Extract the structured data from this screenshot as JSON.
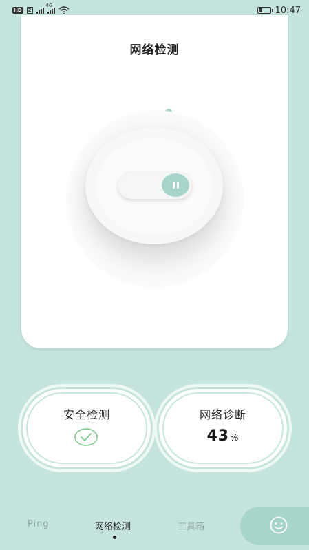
{
  "status_bar": {
    "hd": "HD",
    "sim": "2",
    "network": "4G",
    "time": "10:47"
  },
  "header": {
    "title": "网络检测"
  },
  "detector": {
    "state": "paused"
  },
  "cards": {
    "security": {
      "label": "安全检测",
      "icon": "check-circle-icon"
    },
    "diagnosis": {
      "label": "网络诊断",
      "value": "43",
      "unit": "%"
    }
  },
  "nav": {
    "items": [
      {
        "label": "Ping"
      },
      {
        "label": "网络检测"
      },
      {
        "label": "工具箱"
      }
    ],
    "active_index": 1,
    "extra_icon": "smiley-icon"
  },
  "colors": {
    "background": "#c4e4dd",
    "accent": "#a7d5cc",
    "check": "#7cc98c"
  }
}
